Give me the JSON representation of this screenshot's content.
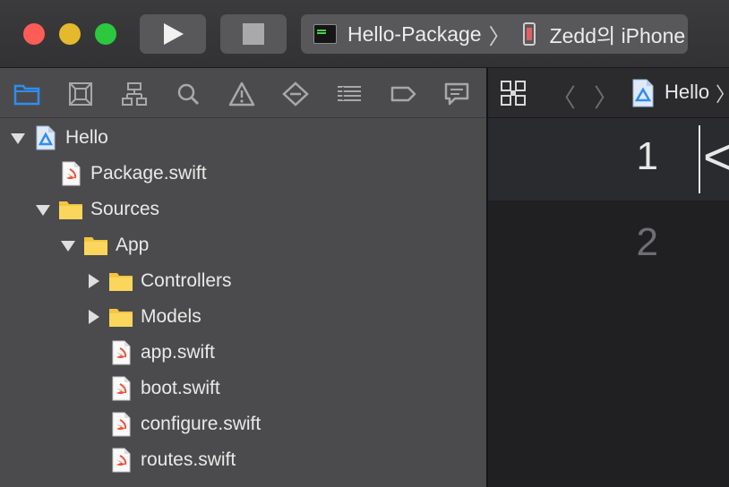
{
  "toolbar": {
    "scheme_name": "Hello-Package",
    "device_name": "Zedd의 iPhone",
    "scheme_separator": "〉"
  },
  "navigator": {
    "tabs": [
      {
        "icon": "folder-icon",
        "active": true
      },
      {
        "icon": "source-control-icon"
      },
      {
        "icon": "symbol-hierarchy-icon"
      },
      {
        "icon": "search-icon"
      },
      {
        "icon": "warning-icon"
      },
      {
        "icon": "test-diamond-icon"
      },
      {
        "icon": "debug-list-icon"
      },
      {
        "icon": "breakpoint-tag-icon"
      },
      {
        "icon": "report-bubble-icon"
      }
    ],
    "tree": [
      {
        "label": "Hello",
        "type": "package",
        "level": 0,
        "disclosure": "open"
      },
      {
        "label": "Package.swift",
        "type": "swift",
        "level": 1,
        "disclosure": "none"
      },
      {
        "label": "Sources",
        "type": "folder",
        "level": 1,
        "disclosure": "open"
      },
      {
        "label": "App",
        "type": "folder",
        "level": 2,
        "disclosure": "open"
      },
      {
        "label": "Controllers",
        "type": "folder",
        "level": 3,
        "disclosure": "closed"
      },
      {
        "label": "Models",
        "type": "folder",
        "level": 3,
        "disclosure": "closed"
      },
      {
        "label": "app.swift",
        "type": "swift",
        "level": 3,
        "disclosure": "none"
      },
      {
        "label": "boot.swift",
        "type": "swift",
        "level": 3,
        "disclosure": "none"
      },
      {
        "label": "configure.swift",
        "type": "swift",
        "level": 3,
        "disclosure": "none"
      },
      {
        "label": "routes.swift",
        "type": "swift",
        "level": 3,
        "disclosure": "none"
      }
    ]
  },
  "editor": {
    "breadcrumb": "Hello",
    "breadcrumb_chevron": "〉",
    "back_glyph": "〈",
    "forward_glyph": "〉",
    "line_numbers": [
      "1",
      "2"
    ],
    "visible_code": "<"
  },
  "colors": {
    "accent": "#2f8ef0",
    "folder": "#f5c542",
    "swift": "#f05138"
  }
}
